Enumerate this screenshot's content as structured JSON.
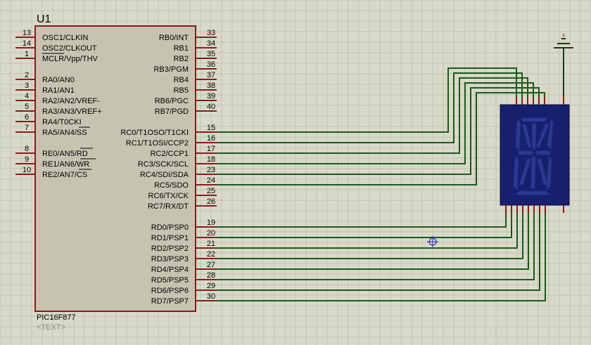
{
  "component": {
    "ref": "U1",
    "part": "PIC16F877",
    "text_placeholder": "<TEXT>"
  },
  "left_pins": [
    {
      "num": "13",
      "name": "OSC1/CLKIN"
    },
    {
      "num": "14",
      "name": "OSC2/CLKOUT"
    },
    {
      "num": "1",
      "name": "MCLR/Vpp/THV"
    },
    {
      "num": "2",
      "name": "RA0/AN0"
    },
    {
      "num": "3",
      "name": "RA1/AN1"
    },
    {
      "num": "4",
      "name": "RA2/AN2/VREF-"
    },
    {
      "num": "5",
      "name": "RA3/AN3/VREF+"
    },
    {
      "num": "6",
      "name": "RA4/T0CKI"
    },
    {
      "num": "7",
      "name": "RA5/AN4/SS"
    },
    {
      "num": "8",
      "name": "RE0/AN5/RD"
    },
    {
      "num": "9",
      "name": "RE1/AN6/WR"
    },
    {
      "num": "10",
      "name": "RE2/AN7/CS"
    }
  ],
  "right_pins": [
    {
      "num": "33",
      "name": "RB0/INT"
    },
    {
      "num": "34",
      "name": "RB1"
    },
    {
      "num": "35",
      "name": "RB2"
    },
    {
      "num": "36",
      "name": "RB3/PGM"
    },
    {
      "num": "37",
      "name": "RB4"
    },
    {
      "num": "38",
      "name": "RB5"
    },
    {
      "num": "39",
      "name": "RB6/PGC"
    },
    {
      "num": "40",
      "name": "RB7/PGD"
    },
    {
      "num": "15",
      "name": "RC0/T1OSO/T1CKI"
    },
    {
      "num": "16",
      "name": "RC1/T1OSI/CCP2"
    },
    {
      "num": "17",
      "name": "RC2/CCP1"
    },
    {
      "num": "18",
      "name": "RC3/SCK/SCL"
    },
    {
      "num": "23",
      "name": "RC4/SDI/SDA"
    },
    {
      "num": "24",
      "name": "RC5/SDO"
    },
    {
      "num": "25",
      "name": "RC6/TX/CK"
    },
    {
      "num": "26",
      "name": "RC7/RX/DT"
    },
    {
      "num": "19",
      "name": "RD0/PSP0"
    },
    {
      "num": "20",
      "name": "RD1/PSP1"
    },
    {
      "num": "21",
      "name": "RD2/PSP2"
    },
    {
      "num": "22",
      "name": "RD3/PSP3"
    },
    {
      "num": "27",
      "name": "RD4/PSP4"
    },
    {
      "num": "28",
      "name": "RD5/PSP5"
    },
    {
      "num": "29",
      "name": "RD6/PSP6"
    },
    {
      "num": "30",
      "name": "RD7/PSP7"
    }
  ],
  "colors": {
    "background": "#d9d9c9",
    "grid": "#c3c3b4",
    "chip_fill": "#c6c4b1",
    "chip_border": "#8b1a1a",
    "pin": "#8b1a1a",
    "wire": "#1a5a1a",
    "display_body": "#17206e",
    "display_segment": "#2b3a95",
    "ground": "#1a3a1a",
    "cursor": "#1a2ab8"
  }
}
